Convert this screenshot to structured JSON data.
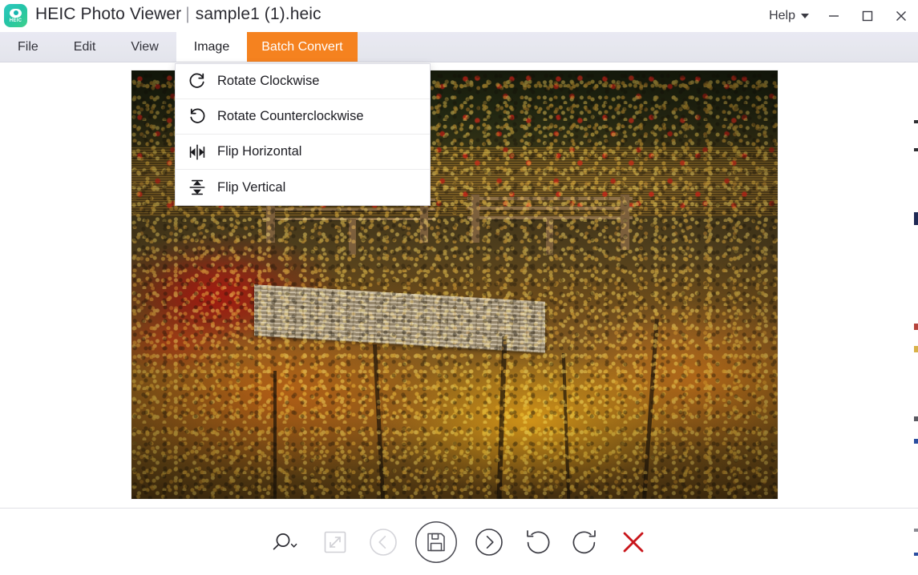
{
  "app": {
    "name": "HEIC Photo Viewer",
    "separator": "|",
    "filename": "sample1 (1).heic",
    "icon_name": "heic-eye-icon",
    "icon_label": "HEIC",
    "accent_color": "#f5821f",
    "menubar_color": "#e6e7ee",
    "close_color": "#d01f1f"
  },
  "titlebar": {
    "help_label": "Help",
    "minimize_label": "Minimize",
    "maximize_label": "Maximize",
    "close_label": "Close"
  },
  "menubar": {
    "items": [
      {
        "label": "File",
        "state": "normal"
      },
      {
        "label": "Edit",
        "state": "normal"
      },
      {
        "label": "View",
        "state": "normal"
      },
      {
        "label": "Image",
        "state": "active"
      },
      {
        "label": "Batch Convert",
        "state": "accent"
      }
    ]
  },
  "dropdown": {
    "open_for": "Image",
    "items": [
      {
        "label": "Rotate Clockwise",
        "icon": "rotate-clockwise-icon"
      },
      {
        "label": "Rotate Counterclockwise",
        "icon": "rotate-counterclockwise-icon"
      },
      {
        "label": "Flip Horizontal",
        "icon": "flip-horizontal-icon"
      },
      {
        "label": "Flip Vertical",
        "icon": "flip-vertical-icon"
      }
    ]
  },
  "photo": {
    "alt": "Autumn forest scene with wooden shed, golden and red foliage",
    "filename": "sample1 (1).heic"
  },
  "toolbar": {
    "buttons": [
      {
        "name": "zoom-dropdown-button",
        "label": "Zoom",
        "icon": "magnifier-icon",
        "state": "enabled"
      },
      {
        "name": "fullscreen-button",
        "label": "Fullscreen",
        "icon": "expand-icon",
        "state": "disabled"
      },
      {
        "name": "previous-image-button",
        "label": "Previous",
        "icon": "chevron-left-circle-icon",
        "state": "disabled"
      },
      {
        "name": "save-button",
        "label": "Save",
        "icon": "floppy-disk-icon",
        "state": "enabled"
      },
      {
        "name": "next-image-button",
        "label": "Next",
        "icon": "chevron-right-circle-icon",
        "state": "enabled"
      },
      {
        "name": "rotate-left-button",
        "label": "Rotate Left",
        "icon": "rotate-counterclockwise-icon",
        "state": "enabled"
      },
      {
        "name": "rotate-right-button",
        "label": "Rotate Right",
        "icon": "rotate-clockwise-icon",
        "state": "enabled"
      },
      {
        "name": "delete-button",
        "label": "Delete",
        "icon": "close-x-icon",
        "state": "enabled"
      }
    ]
  }
}
